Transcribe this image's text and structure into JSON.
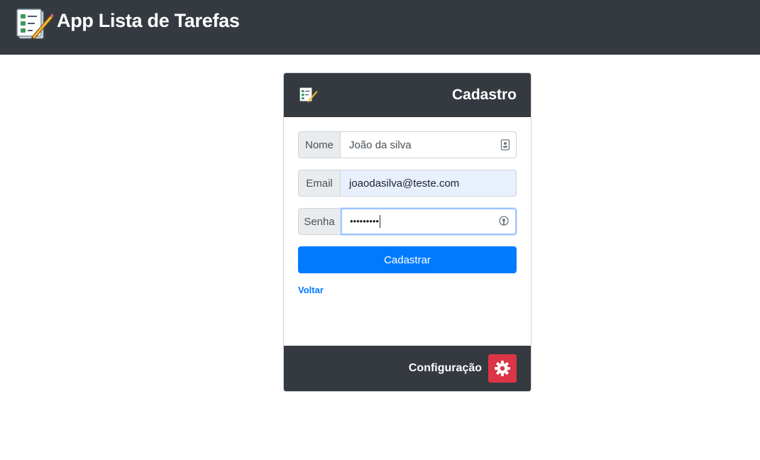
{
  "app": {
    "title": "App Lista de Tarefas",
    "logo_icon": "checklist-pencil-icon"
  },
  "card": {
    "title": "Cadastro",
    "icon": "checklist-pencil-icon",
    "form": {
      "name": {
        "label": "Nome",
        "value": "João da silva",
        "icon": "contact-card-icon"
      },
      "email": {
        "label": "Email",
        "value": "joaodasilva@teste.com"
      },
      "password": {
        "label": "Senha",
        "masked_value": "•••••••••",
        "icon": "password-key-icon"
      },
      "submit_label": "Cadastrar"
    },
    "back_link": "Voltar",
    "footer": {
      "config_label": "Configuração",
      "config_icon": "gear-icon"
    }
  },
  "colors": {
    "dark": "#343a40",
    "primary": "#007bff",
    "danger": "#dc3545",
    "autofill": "#e8f0fe"
  }
}
